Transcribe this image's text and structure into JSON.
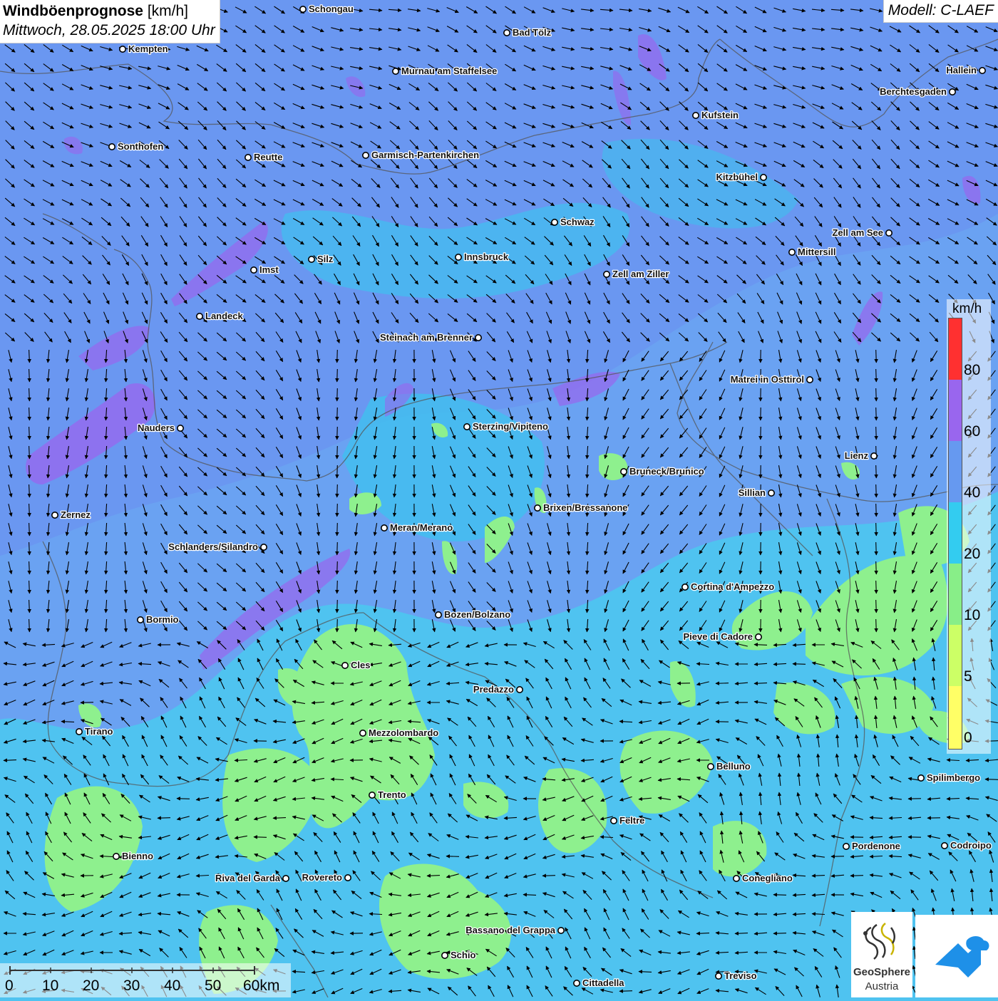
{
  "title": {
    "main": "Windböenprognose",
    "unit": "[km/h]",
    "datetime": "Mittwoch, 28.05.2025 18:00 Uhr"
  },
  "model": "Modell: C-LAEF",
  "legend": {
    "unit": "km/h",
    "labels": [
      "80",
      "60",
      "40",
      "20",
      "10",
      "5",
      "0"
    ],
    "colors": [
      "#ff3030",
      "#9966ee",
      "#6699f0",
      "#33ccf0",
      "#88ee88",
      "#ccff66",
      "#ffff66"
    ]
  },
  "scale_bar": {
    "labels": [
      "0",
      "10",
      "20",
      "30",
      "40",
      "50",
      "60km"
    ]
  },
  "logos": {
    "geosphere_name": "GeoSphere",
    "geosphere_sub": "Austria"
  },
  "places": [
    {
      "name": "Schongau"
    },
    {
      "name": "Kempten"
    },
    {
      "name": "Bad Tölz"
    },
    {
      "name": "Murnau am Staffelsee"
    },
    {
      "name": "Hallein"
    },
    {
      "name": "Berchtesgaden"
    },
    {
      "name": "Kufstein"
    },
    {
      "name": "Sonthofen"
    },
    {
      "name": "Reutte"
    },
    {
      "name": "Garmisch-Partenkirchen"
    },
    {
      "name": "Kitzbühel"
    },
    {
      "name": "Schwaz"
    },
    {
      "name": "Zell am See"
    },
    {
      "name": "Mittersill"
    },
    {
      "name": "Imst"
    },
    {
      "name": "Silz"
    },
    {
      "name": "Innsbruck"
    },
    {
      "name": "Zell am Ziller"
    },
    {
      "name": "Landeck"
    },
    {
      "name": "Steinach am Brenner"
    },
    {
      "name": "Matrei in Osttirol"
    },
    {
      "name": "Nauders"
    },
    {
      "name": "Sterzing/Vipiteno"
    },
    {
      "name": "Lienz"
    },
    {
      "name": "Bruneck/Brunico"
    },
    {
      "name": "Sillian"
    },
    {
      "name": "Zernez"
    },
    {
      "name": "Brixen/Bressanone"
    },
    {
      "name": "Meran/Merano"
    },
    {
      "name": "Schlanders/Silandro"
    },
    {
      "name": "Cortina d'Ampezzo"
    },
    {
      "name": "Bozen/Bolzano"
    },
    {
      "name": "Bormio"
    },
    {
      "name": "Pieve di Cadore"
    },
    {
      "name": "Cles"
    },
    {
      "name": "Predazzo"
    },
    {
      "name": "Tirano"
    },
    {
      "name": "Mezzolombardo"
    },
    {
      "name": "Belluno"
    },
    {
      "name": "Spilimbergo"
    },
    {
      "name": "Trento"
    },
    {
      "name": "Feltre"
    },
    {
      "name": "Pordenone"
    },
    {
      "name": "Codroipo"
    },
    {
      "name": "Bienno"
    },
    {
      "name": "Riva del Garda"
    },
    {
      "name": "Rovereto"
    },
    {
      "name": "Conegliano"
    },
    {
      "name": "Bassano del Grappa"
    },
    {
      "name": "Schio"
    },
    {
      "name": "Treviso"
    },
    {
      "name": "Cittadella"
    }
  ]
}
